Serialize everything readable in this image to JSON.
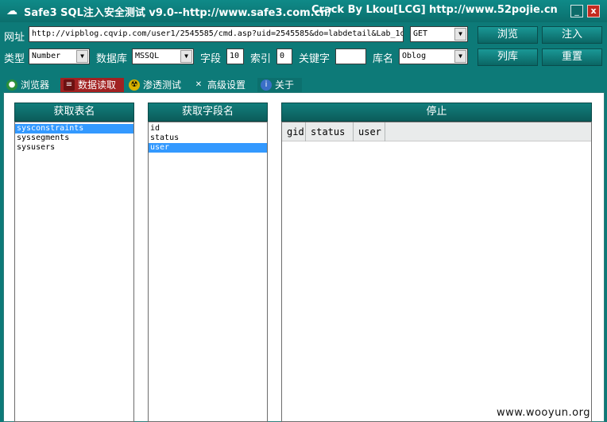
{
  "window": {
    "title": "Safe3 SQL注入安全测试 v9.0--http://www.safe3.com.cn/",
    "crack": "Crack  By  Lkou[LCG]",
    "crack_url": "http://www.52pojie.cn",
    "min_label": "_",
    "close_label": "x"
  },
  "form": {
    "url_label": "网址",
    "url_value": "http://vipblog.cqvip.com/user1/2545585/cmd.asp?uid=2545585&do=labdetail&Lab_1d",
    "method": "GET",
    "type_label": "类型",
    "type_value": "Number",
    "db_label": "数据库",
    "db_value": "MSSQL",
    "field_label": "字段",
    "field_value": "10",
    "index_label": "索引",
    "index_value": "0",
    "keyword_label": "关键字",
    "keyword_value": "",
    "dbname_label": "库名",
    "dbname_value": "Oblog"
  },
  "buttons": {
    "browse": "浏览",
    "inject": "注入",
    "list_db": "列库",
    "reset": "重置"
  },
  "tabs": [
    {
      "label": "浏览器"
    },
    {
      "label": "数据读取"
    },
    {
      "label": "渗透测试"
    },
    {
      "label": "高级设置"
    },
    {
      "label": "关于"
    }
  ],
  "panel": {
    "tables_header": "获取表名",
    "fields_header": "获取字段名",
    "stop_header": "停止",
    "tables": [
      "sysconstraints",
      "syssegments",
      "sysusers"
    ],
    "fields": [
      "id",
      "status",
      "user"
    ],
    "columns": [
      "gid",
      "status",
      "user"
    ]
  },
  "watermark": "www.wooyun.org",
  "colors": {
    "accent": "#0d7a78",
    "selection": "#3399ff",
    "active_tab": "#a12222"
  }
}
